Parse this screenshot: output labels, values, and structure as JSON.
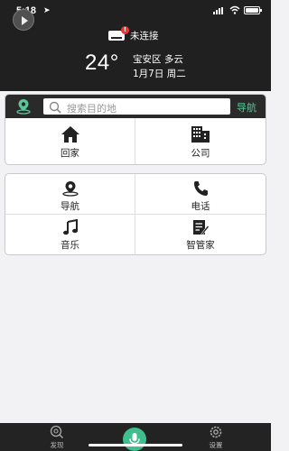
{
  "status_bar": {
    "time": "5:18",
    "location_arrow": "location-arrow-icon"
  },
  "connection": {
    "label": "未连接",
    "badge": "!"
  },
  "weather": {
    "temperature": "24°",
    "location_condition": "宝安区 多云",
    "date": "1月7日 周二"
  },
  "search": {
    "placeholder": "搜索目的地",
    "nav_label": "导航"
  },
  "quick_places": [
    {
      "label": "回家",
      "icon": "home-icon"
    },
    {
      "label": "公司",
      "icon": "office-building-icon"
    }
  ],
  "functions": [
    {
      "label": "导航",
      "icon": "navigation-pin-icon"
    },
    {
      "label": "电话",
      "icon": "phone-icon"
    },
    {
      "label": "音乐",
      "icon": "music-note-icon"
    },
    {
      "label": "智管家",
      "icon": "edit-note-icon"
    }
  ],
  "tabbar": {
    "discover": "发现",
    "settings": "设置"
  },
  "colors": {
    "header_bg": "#202020",
    "accent_green": "#5cc69a",
    "mic_green": "#3fbf8e",
    "page_bg": "#f2f2f4"
  }
}
